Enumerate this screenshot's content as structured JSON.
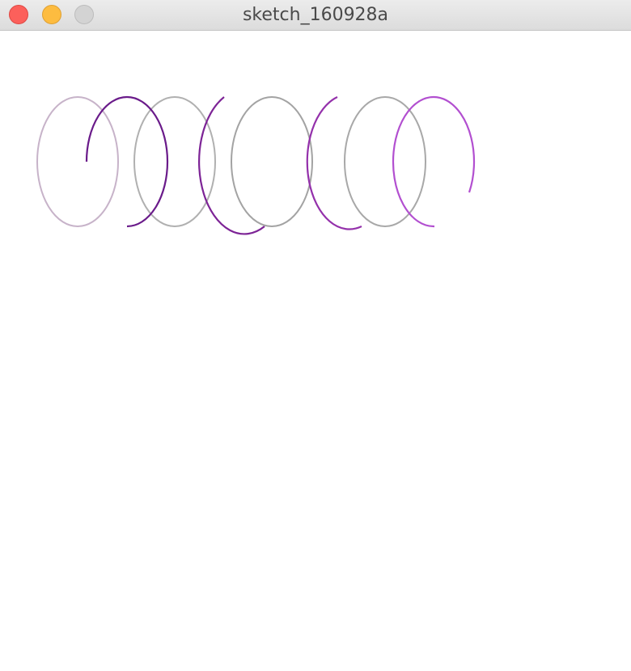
{
  "window": {
    "title": "sketch_160928a",
    "buttons": {
      "close_color": "#fc605b",
      "minimize_color": "#fdbc40",
      "zoom_color": "#d3d3d3"
    }
  },
  "canvas": {
    "background": "#ffffff",
    "gray_ring_color": "#a3a3a3",
    "purple_ring_colors": [
      "#6a1b8a",
      "#7d2496",
      "#9431ab",
      "#b24fd0"
    ]
  }
}
